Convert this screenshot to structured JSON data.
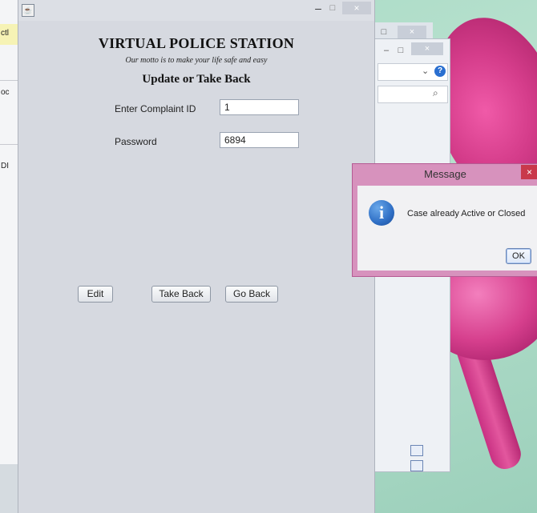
{
  "left_strip": {
    "snippets": [
      "ctl",
      "oc",
      "DI"
    ]
  },
  "window": {
    "title_bar": {
      "minimize": "–",
      "maximize": "□",
      "close": "×"
    },
    "app_title": "VIRTUAL POLICE STATION",
    "motto": "Our motto is to make your life safe and easy",
    "form_heading": "Update or Take Back",
    "fields": {
      "complaint_id": {
        "label": "Enter Complaint ID",
        "value": "1"
      },
      "password": {
        "label": "Password",
        "value": "6894"
      }
    },
    "buttons": {
      "edit": "Edit",
      "take_back": "Take Back",
      "go_back": "Go Back"
    }
  },
  "explorer": {
    "minimize": "–",
    "maximize": "□",
    "close": "×",
    "address_dropdown": "⌄",
    "help": "?",
    "search_icon": "⌕"
  },
  "dialog": {
    "title": "Message",
    "close": "×",
    "message": "Case already Active or Closed",
    "ok_label": "OK",
    "icon": "info-icon"
  },
  "colors": {
    "window_bg": "#d6d9e0",
    "dialog_frame": "#d792bd",
    "close_red": "#c9394b"
  }
}
